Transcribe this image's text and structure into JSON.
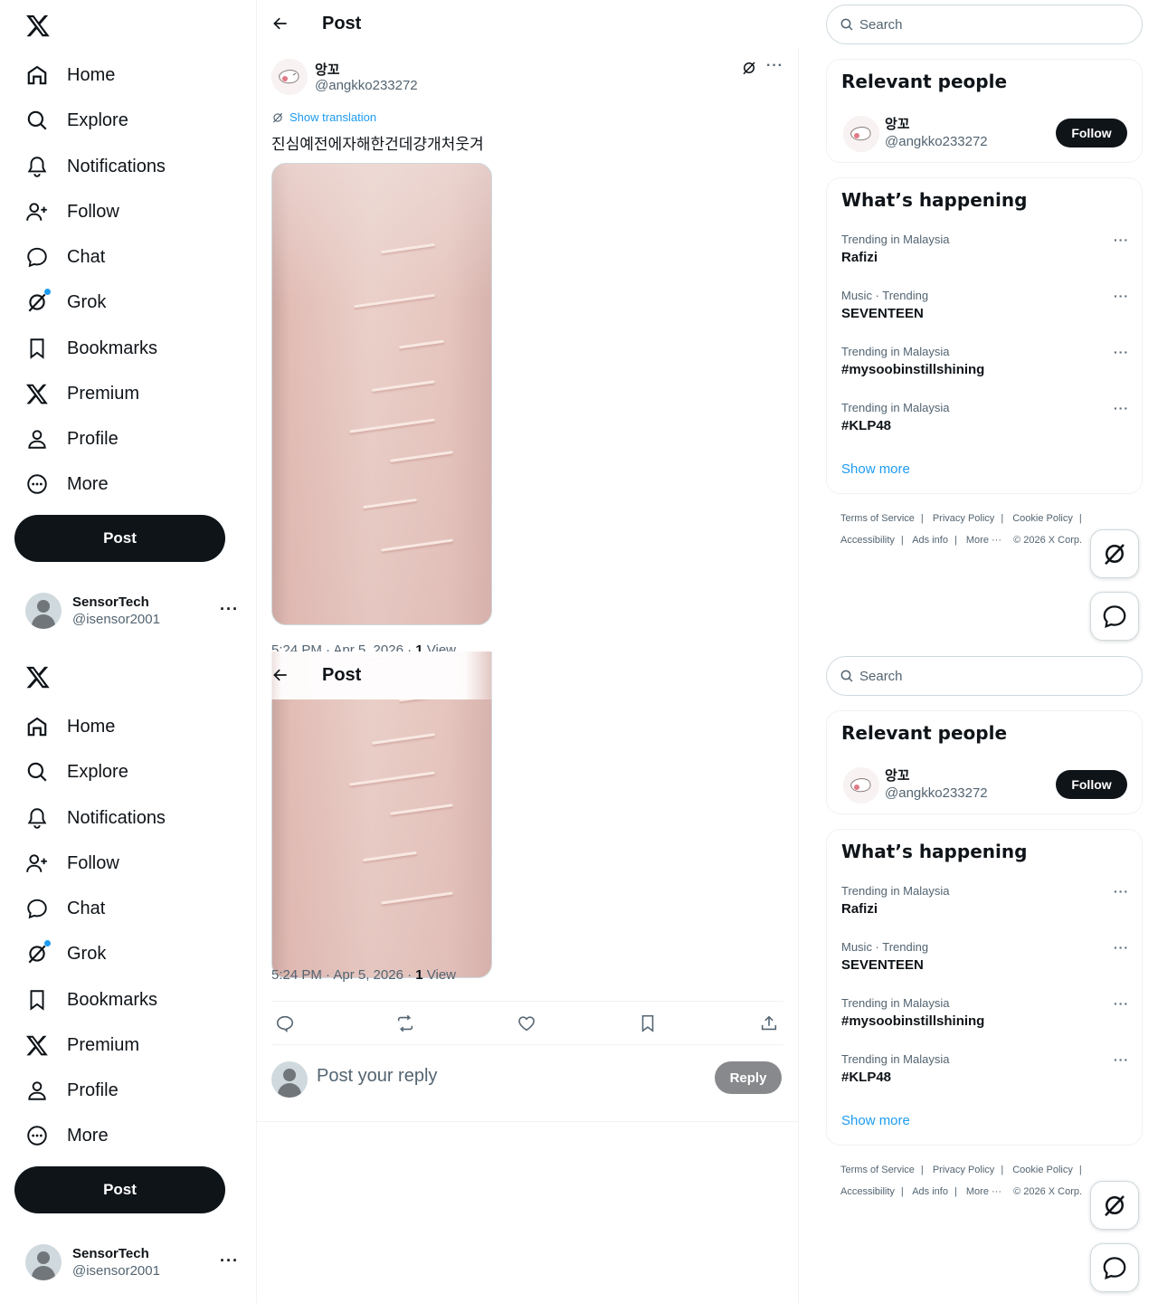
{
  "nav": {
    "items": [
      {
        "label": "Home",
        "icon": "home-icon"
      },
      {
        "label": "Explore",
        "icon": "search-icon"
      },
      {
        "label": "Notifications",
        "icon": "bell-icon"
      },
      {
        "label": "Follow",
        "icon": "person-add-icon"
      },
      {
        "label": "Chat",
        "icon": "chat-icon"
      },
      {
        "label": "Grok",
        "icon": "grok-icon"
      },
      {
        "label": "Bookmarks",
        "icon": "bookmark-icon"
      },
      {
        "label": "Premium",
        "icon": "x-logo-icon"
      },
      {
        "label": "Profile",
        "icon": "person-icon"
      },
      {
        "label": "More",
        "icon": "more-circle-icon"
      }
    ],
    "post_button": "Post"
  },
  "account": {
    "name": "SensorTech",
    "handle": "@isensor2001"
  },
  "header": {
    "title": "Post"
  },
  "tweet": {
    "author_name": "앙꼬",
    "author_handle": "@angkko233272",
    "show_translation": "Show translation",
    "text": "진심예전에자해한건데걍개처웃겨",
    "time": "5:24 PM · Apr 5, 2026 · ",
    "views_count": "1",
    "views_label": " View"
  },
  "reply": {
    "placeholder": "Post your reply",
    "button": "Reply"
  },
  "search": {
    "placeholder": "Search"
  },
  "relevant": {
    "title": "Relevant people",
    "name": "앙꼬",
    "handle": "@angkko233272",
    "follow": "Follow"
  },
  "happening": {
    "title": "What’s happening",
    "trends": [
      {
        "meta": "Trending in Malaysia",
        "name": "Rafizi"
      },
      {
        "meta": "Music · Trending",
        "name": "SEVENTEEN"
      },
      {
        "meta": "Trending in Malaysia",
        "name": "#mysoobinstillshining"
      },
      {
        "meta": "Trending in Malaysia",
        "name": "#KLP48"
      }
    ],
    "show_more": "Show more"
  },
  "footer": {
    "terms": "Terms of Service",
    "privacy": "Privacy Policy",
    "cookie": "Cookie Policy",
    "accessibility": "Accessibility",
    "ads": "Ads info",
    "more": "More ···",
    "copyright": "© 2026 X Corp."
  },
  "colors": {
    "accent": "#1d9bf0",
    "text": "#0f1419",
    "muted": "#536471",
    "button_dark": "#0f1419"
  }
}
